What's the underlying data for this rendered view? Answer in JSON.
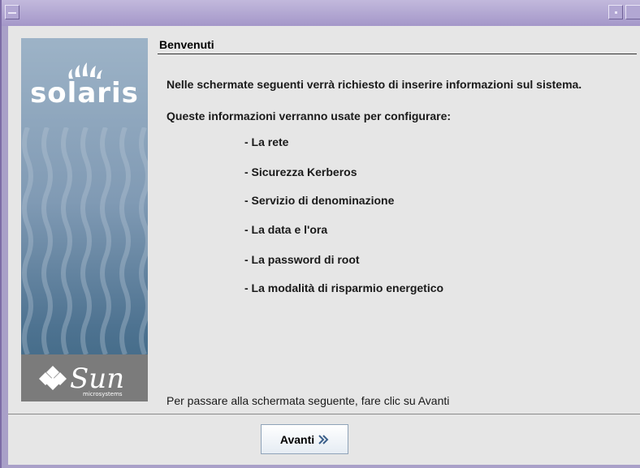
{
  "window": {
    "title": ""
  },
  "sidebar": {
    "brand_name": "solaris",
    "vendor_name": "Sun",
    "vendor_sub": "microsystems"
  },
  "panel": {
    "heading": "Benvenuti",
    "intro": "Nelle schermate seguenti verrà richiesto di inserire informazioni sul sistema.",
    "subtitle": "Queste informazioni verranno usate per configurare:",
    "items": [
      "- La rete",
      "- Sicurezza Kerberos",
      "- Servizio di denominazione",
      "- La data e l'ora",
      "- La password di root",
      "- La modalità di risparmio energetico"
    ],
    "footer_note": "Per passare alla schermata seguente, fare clic su Avanti"
  },
  "buttons": {
    "next_label": "Avanti"
  },
  "colors": {
    "titlebar": "#a497c9",
    "content_bg": "#e6e6e6",
    "button_border": "#8fa3b8"
  }
}
